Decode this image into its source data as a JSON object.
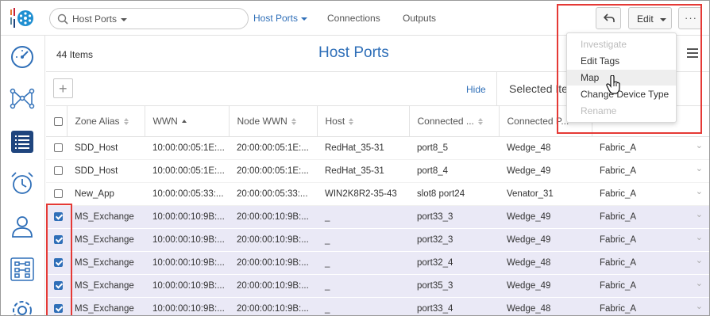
{
  "search": {
    "placeholder": "Host Ports"
  },
  "tabs": [
    {
      "label": "Host Ports"
    },
    {
      "label": "Connections"
    },
    {
      "label": "Outputs"
    }
  ],
  "toolbar": {
    "edit_label": "Edit",
    "more_label": "···"
  },
  "page": {
    "item_count": "44 Items",
    "title": "Host Ports",
    "hide_label": "Hide",
    "selected_label": "Selected Ite"
  },
  "edit_menu": [
    {
      "label": "Investigate",
      "disabled": true
    },
    {
      "label": "Edit Tags",
      "disabled": false
    },
    {
      "label": "Map",
      "disabled": false
    },
    {
      "label": "Change Device Type",
      "disabled": false
    },
    {
      "label": "Rename",
      "disabled": true
    }
  ],
  "table": {
    "columns": [
      "Zone Alias",
      "WWN",
      "Node WWN",
      "Host",
      "Connected ...",
      "Connected P...",
      ""
    ],
    "rows": [
      {
        "checked": false,
        "cells": [
          "SDD_Host",
          "10:00:00:05:1E:...",
          "20:00:00:05:1E:...",
          "RedHat_35-31",
          "port8_5",
          "Wedge_48",
          "Fabric_A"
        ]
      },
      {
        "checked": false,
        "cells": [
          "SDD_Host",
          "10:00:00:05:1E:...",
          "20:00:00:05:1E:...",
          "RedHat_35-31",
          "port8_4",
          "Wedge_49",
          "Fabric_A"
        ]
      },
      {
        "checked": false,
        "cells": [
          "New_App",
          "10:00:00:05:33:...",
          "20:00:00:05:33:...",
          "WIN2K8R2-35-43",
          "slot8 port24",
          "Venator_31",
          "Fabric_A"
        ]
      },
      {
        "checked": true,
        "cells": [
          "MS_Exchange",
          "10:00:00:10:9B:...",
          "20:00:00:10:9B:...",
          "_",
          "port33_3",
          "Wedge_49",
          "Fabric_A"
        ]
      },
      {
        "checked": true,
        "cells": [
          "MS_Exchange",
          "10:00:00:10:9B:...",
          "20:00:00:10:9B:...",
          "_",
          "port32_3",
          "Wedge_49",
          "Fabric_A"
        ]
      },
      {
        "checked": true,
        "cells": [
          "MS_Exchange",
          "10:00:00:10:9B:...",
          "20:00:00:10:9B:...",
          "_",
          "port32_4",
          "Wedge_48",
          "Fabric_A"
        ]
      },
      {
        "checked": true,
        "cells": [
          "MS_Exchange",
          "10:00:00:10:9B:...",
          "20:00:00:10:9B:...",
          "_",
          "port35_3",
          "Wedge_49",
          "Fabric_A"
        ]
      },
      {
        "checked": true,
        "cells": [
          "MS_Exchange",
          "10:00:00:10:9B:...",
          "20:00:00:10:9B:...",
          "_",
          "port33_4",
          "Wedge_48",
          "Fabric_A"
        ]
      }
    ]
  },
  "colors": {
    "accent": "#2f6fb8",
    "selected_row": "#eae9f6",
    "highlight_box": "#e53935"
  },
  "icons": {
    "nav": [
      "dashboard-icon",
      "topology-icon",
      "list-icon",
      "alarm-icon",
      "user-icon",
      "grid-icon",
      "settings-icon"
    ]
  }
}
